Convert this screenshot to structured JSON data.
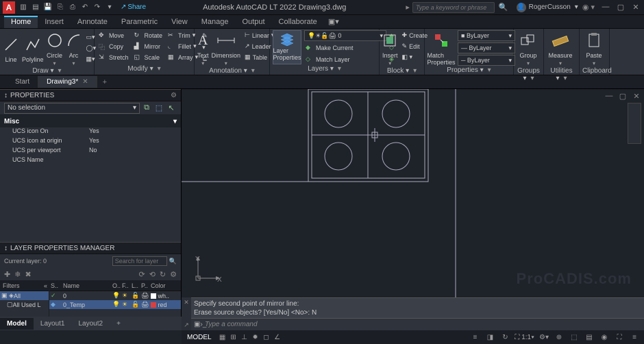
{
  "title": "Autodesk AutoCAD LT 2022   Drawing3.dwg",
  "search_placeholder": "Type a keyword or phrase",
  "user": "RogerCusson",
  "share": "Share",
  "menutabs": [
    "Home",
    "Insert",
    "Annotate",
    "Parametric",
    "View",
    "Manage",
    "Output",
    "Collaborate"
  ],
  "ribbon": {
    "draw": {
      "title": "Draw ▾",
      "items": [
        "Line",
        "Polyline",
        "Circle",
        "Arc"
      ]
    },
    "modify": {
      "title": "Modify ▾",
      "rows": [
        [
          "Move",
          "Rotate",
          "Trim"
        ],
        [
          "Copy",
          "Mirror",
          "Fillet"
        ],
        [
          "Stretch",
          "Scale",
          "Array"
        ]
      ]
    },
    "annotation": {
      "title": "Annotation ▾",
      "text": "Text",
      "dim": "Dimension",
      "table": "Table",
      "linear": "Linear",
      "leader": "Leader"
    },
    "layers": {
      "title": "Layers ▾",
      "btn": "Layer Properties",
      "make": "Make Current",
      "match": "Match Layer",
      "combo": "0"
    },
    "block": {
      "title": "Block ▾",
      "insert": "Insert",
      "create": "Create",
      "edit": "Edit"
    },
    "properties": {
      "title": "Properties ▾",
      "match": "Match Properties",
      "bylayer": "ByLayer"
    },
    "groups": {
      "title": "Groups ▾",
      "group": "Group"
    },
    "utilities": {
      "title": "Utilities ▾",
      "measure": "Measure"
    },
    "clipboard": {
      "title": "Clipboard",
      "paste": "Paste"
    }
  },
  "doctabs": {
    "start": "Start",
    "active": "Drawing3*"
  },
  "properties_palette": {
    "title": "PROPERTIES",
    "sel": "No selection",
    "cat": "Misc",
    "rows": [
      {
        "k": "UCS icon On",
        "v": "Yes"
      },
      {
        "k": "UCS icon at origin",
        "v": "Yes"
      },
      {
        "k": "UCS per viewport",
        "v": "No"
      },
      {
        "k": "UCS Name",
        "v": ""
      }
    ]
  },
  "layer_mgr": {
    "title": "LAYER PROPERTIES MANAGER",
    "current": "Current layer: 0",
    "search_ph": "Search for layer",
    "filters_hdr": "Filters",
    "filter_all": "All",
    "filter_used": "All Used L",
    "cols": [
      "S..",
      "Name",
      "O..",
      "F..",
      "L..",
      "P..",
      "Color"
    ],
    "rows": [
      {
        "name": "0",
        "color": "wh..",
        "sel": false,
        "statusColor": "#6fb66f",
        "swatch": "#ffffff"
      },
      {
        "name": "0_Temp",
        "color": "red",
        "sel": true,
        "statusColor": "#6fa4d8",
        "swatch": "#d84040"
      }
    ]
  },
  "cmd": {
    "line1": "Specify second point of mirror line:",
    "line2": "Erase source objects? [Yes/No] <No>: N",
    "prompt": "Type a command"
  },
  "layouts": [
    "Model",
    "Layout1",
    "Layout2"
  ],
  "status": {
    "model": "MODEL",
    "scale": "1:1"
  },
  "watermark": "ProCADIS.com"
}
